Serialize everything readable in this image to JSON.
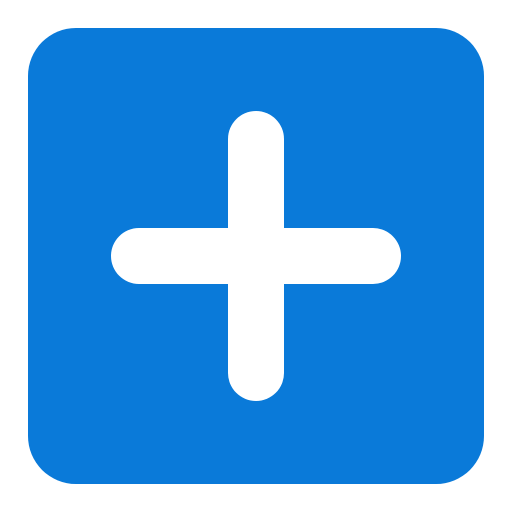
{
  "add_button": {
    "icon": "plus-icon",
    "background_color": "#0A7AD9",
    "icon_color": "#FFFFFF"
  }
}
